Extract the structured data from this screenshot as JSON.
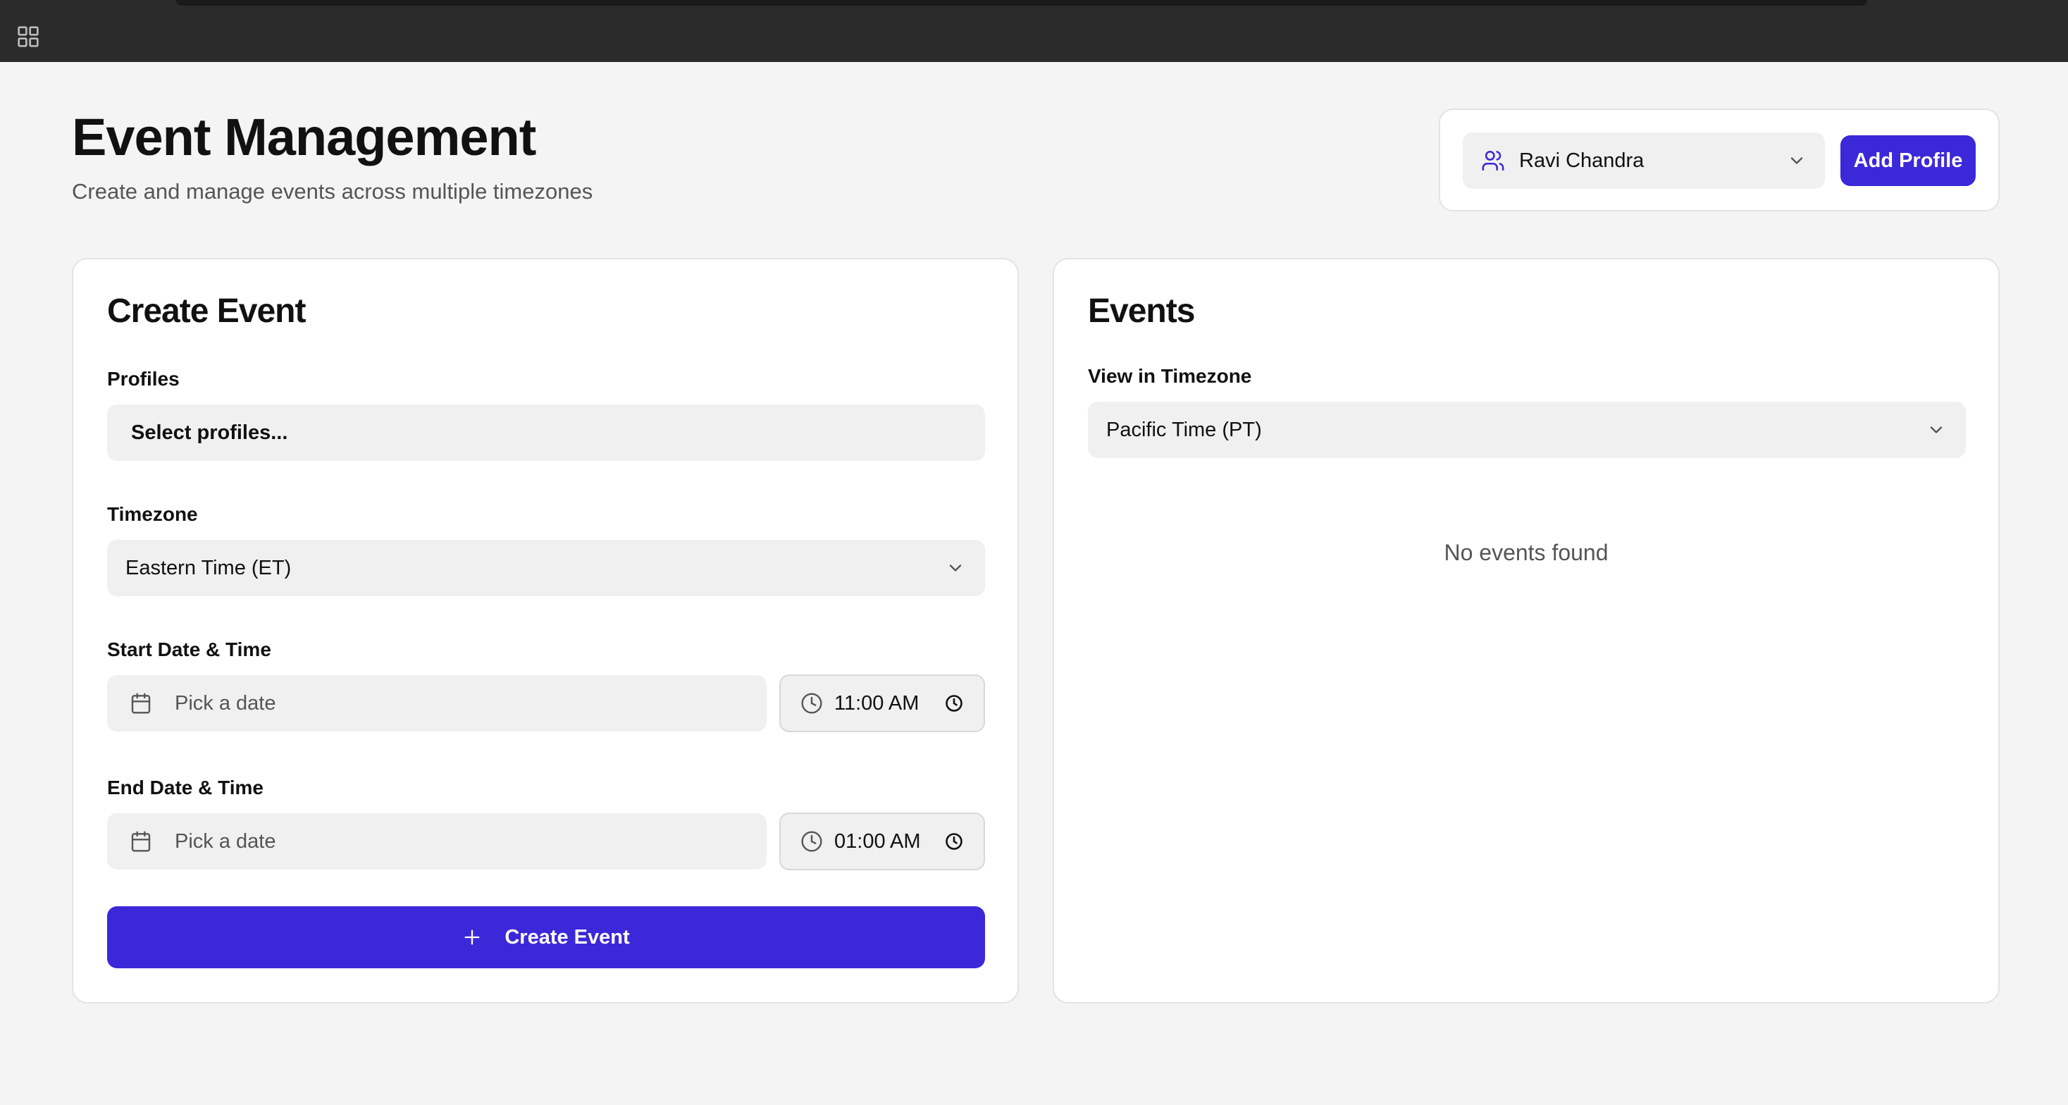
{
  "header": {
    "title": "Event Management",
    "subtitle": "Create and manage events across multiple timezones"
  },
  "profile_bar": {
    "selected_profile": "Ravi Chandra",
    "add_profile_label": "Add Profile"
  },
  "create_event": {
    "title": "Create Event",
    "profiles_label": "Profiles",
    "profiles_placeholder": "Select profiles...",
    "timezone_label": "Timezone",
    "timezone_value": "Eastern Time (ET)",
    "start_label": "Start Date & Time",
    "start_date_placeholder": "Pick a date",
    "start_time": "11:00 AM",
    "end_label": "End Date & Time",
    "end_date_placeholder": "Pick a date",
    "end_time": "01:00 AM",
    "submit_label": "Create Event"
  },
  "events": {
    "title": "Events",
    "view_timezone_label": "View in Timezone",
    "view_timezone_value": "Pacific Time (PT)",
    "empty_message": "No events found"
  },
  "colors": {
    "accent": "#3b28d9",
    "background": "#f4f4f4",
    "card": "#ffffff",
    "topbar": "#2b2b2b"
  },
  "icons": [
    "apps-grid-icon",
    "users-icon",
    "chevron-down-icon",
    "calendar-icon",
    "clock-icon",
    "plus-icon"
  ]
}
